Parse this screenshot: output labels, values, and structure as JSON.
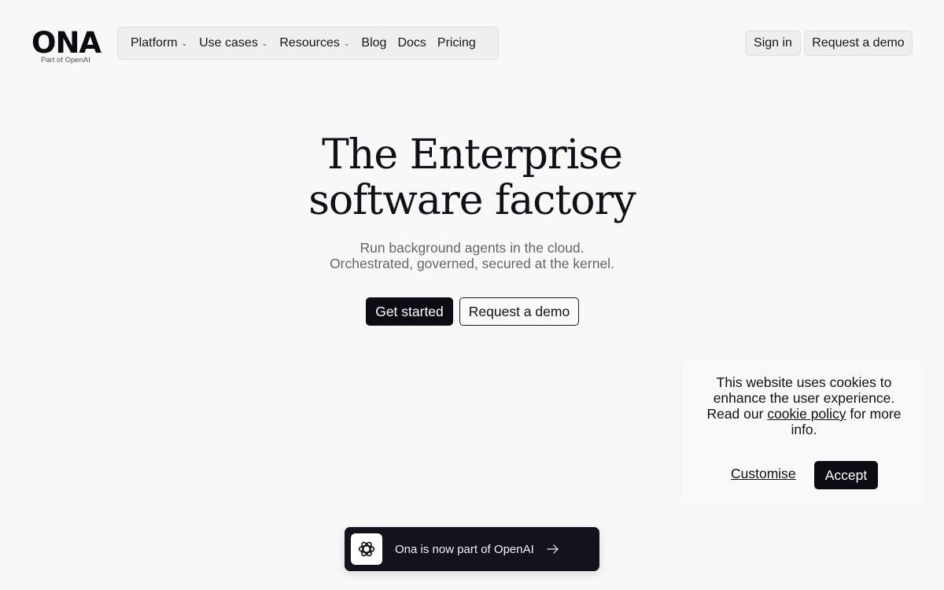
{
  "brand": {
    "name": "ONA",
    "tagline": "Part of OpenAI"
  },
  "nav": {
    "items": [
      {
        "label": "Platform",
        "has_dropdown": true
      },
      {
        "label": "Use cases",
        "has_dropdown": true
      },
      {
        "label": "Resources",
        "has_dropdown": true
      },
      {
        "label": "Blog",
        "has_dropdown": false
      },
      {
        "label": "Docs",
        "has_dropdown": false
      },
      {
        "label": "Pricing",
        "has_dropdown": false
      }
    ],
    "chevron_icon": "chevron-down-icon"
  },
  "header_actions": {
    "sign_in": "Sign in",
    "request_demo": "Request a demo"
  },
  "hero": {
    "title_line1": "The Enterprise",
    "title_line2": "software factory",
    "subtitle_line1": "Run background agents in the cloud.",
    "subtitle_line2": "Orchestrated, governed, secured at the kernel.",
    "primary_cta": "Get started",
    "secondary_cta": "Request a demo"
  },
  "cookie_banner": {
    "text_before": "This website uses cookies to enhance the user experience. Read our ",
    "link_text": "cookie policy",
    "text_after": " for more info.",
    "customise_label": "Customise",
    "accept_label": "Accept"
  },
  "announcement": {
    "icon": "openai-logo-icon",
    "text": "Ona is now part of OpenAI",
    "arrow_icon": "arrow-right-icon"
  },
  "colors": {
    "background": "#f8f8f8",
    "primary_button": "#0c0d14",
    "banner_bg": "#12131d",
    "nav_bg": "#efefef",
    "subtitle_text": "#666666"
  }
}
